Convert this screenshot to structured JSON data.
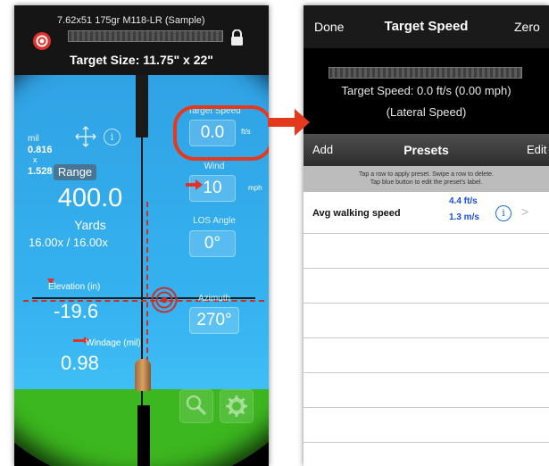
{
  "left": {
    "ammo": "7.62x51 175gr M118-LR (Sample)",
    "target_size": "Target Size: 11.75\" x 22\"",
    "mil_label": "mil",
    "mil_value": "0.816",
    "mil_x": "x",
    "mil_value2": "1.528",
    "range_button": "Range",
    "range_value": "400.0",
    "range_unit": "Yards",
    "zoom": "16.00x / 16.00x",
    "target_speed_label": "Target Speed",
    "target_speed_value": "0.0",
    "target_speed_unit": "ft/s",
    "wind_label": "Wind",
    "wind_value": "10",
    "wind_unit": "mph",
    "los_label": "LOS Angle",
    "los_value": "0°",
    "azimuth_label": "Azimuth",
    "azimuth_value": "270°",
    "elevation_label": "Elevation (in)",
    "elevation_value": "-19.6",
    "windage_label": "Windage (mil)",
    "windage_value": "0.98",
    "info_glyph": "i"
  },
  "right": {
    "done": "Done",
    "title": "Target Speed",
    "zero": "Zero",
    "speed": "Target Speed: 0.0 ft/s (0.00 mph)",
    "lateral": "(Lateral Speed)",
    "add": "Add",
    "presets": "Presets",
    "edit": "Edit",
    "hint1": "Tap a row to apply preset.  Swipe a row to delete.",
    "hint2": "Tap blue button to edit the preset's label.",
    "preset_rows": [
      {
        "name": "Avg walking speed",
        "v1": "4.4 ft/s",
        "v2": "1.3 m/s",
        "info": "i",
        "chevron": ">"
      }
    ]
  },
  "colors": {
    "accent_red": "#e33a1e",
    "preset_value_blue": "#1a4ee0",
    "sky": "#35b2f0",
    "grass": "#3cb71f"
  }
}
